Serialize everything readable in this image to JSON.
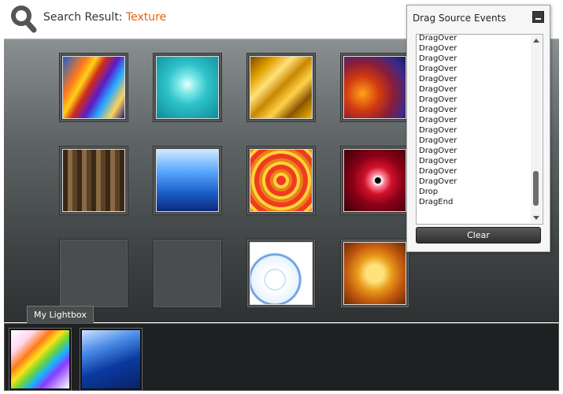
{
  "header": {
    "label": "Search Result:",
    "term": "Texture",
    "search_icon": "search-icon"
  },
  "gallery": {
    "rows": [
      [
        {
          "empty": false,
          "texture": "abstract-swirl"
        },
        {
          "empty": false,
          "texture": "aqua-burst"
        },
        {
          "empty": false,
          "texture": "gold-waves"
        },
        {
          "empty": false,
          "texture": "red-spiral"
        }
      ],
      [
        {
          "empty": false,
          "texture": "woven-basket"
        },
        {
          "empty": false,
          "texture": "blue-bubbles"
        },
        {
          "empty": false,
          "texture": "psychedelic-rings"
        },
        {
          "empty": false,
          "texture": "red-vortex"
        }
      ],
      [
        {
          "empty": true
        },
        {
          "empty": true
        },
        {
          "empty": false,
          "texture": "blue-circles-white"
        },
        {
          "empty": false,
          "texture": "gold-dots"
        }
      ]
    ]
  },
  "lightbox": {
    "tab_label": "My Lightbox",
    "items": [
      {
        "texture": "rainbow-streaks"
      },
      {
        "texture": "blue-flow"
      }
    ]
  },
  "events_window": {
    "title": "Drag Source Events",
    "clear_label": "Clear",
    "events": [
      "DragOver",
      "DragOver",
      "DragOver",
      "DragOver",
      "DragOver",
      "DragOver",
      "DragOver",
      "DragOver",
      "DragOver",
      "DragOver",
      "DragOver",
      "DragOver",
      "DragOver",
      "DragOver",
      "DragOver",
      "Drop",
      "DragEnd"
    ],
    "scroll_position": 0.9
  },
  "colors": {
    "accent": "#e8620f",
    "panel_dark": "#3e4243"
  }
}
